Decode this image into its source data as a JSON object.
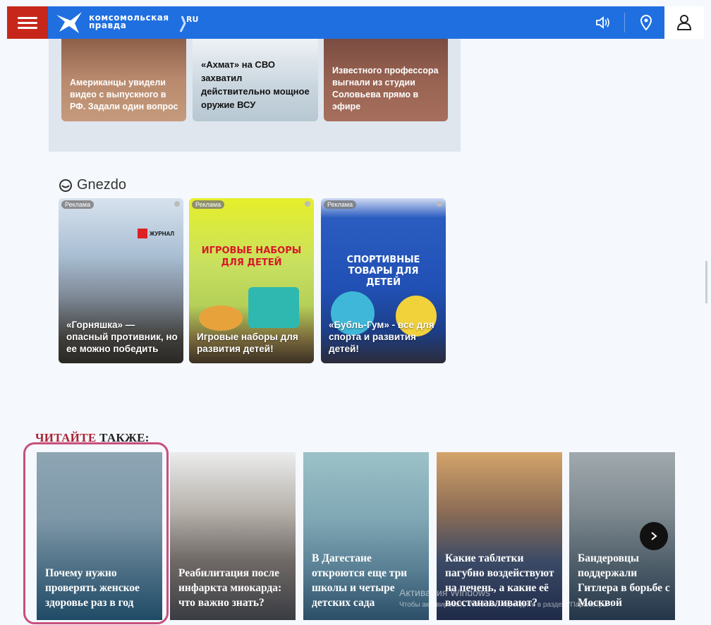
{
  "header": {
    "menu_icon": "menu-icon",
    "logo_line1": "комсомольская",
    "logo_line2": "правда",
    "logo_badge": "RU",
    "sound_icon": "speaker-icon",
    "location_icon": "location-pin-icon",
    "user_icon": "user-icon",
    "colors": {
      "bar": "#1f6fe0",
      "menu": "#c7271b"
    }
  },
  "top_news": [
    {
      "title": "Американцы увидели видео с выпускного в РФ. Задали один вопрос",
      "color": "#b58768"
    },
    {
      "title": "«Ахмат» на СВО захватил действительно мощное оружие ВСУ",
      "color": "#c9d6df"
    },
    {
      "title": "Известного профессора выгнали из студии Соловьева прямо в эфире",
      "color": "#9c6655"
    }
  ],
  "gnezdo": {
    "logo": "Gnezdo",
    "ads": [
      {
        "label": "Реклама",
        "title": "«Горняшка» — опасный противник, но ее можно победить",
        "brand": "ЖУРНАЛ"
      },
      {
        "label": "Реклама",
        "title": "Игровые наборы для развития детей!",
        "inner": "ИГРОВЫЕ НАБОРЫ ДЛЯ ДЕТЕЙ"
      },
      {
        "label": "Реклама",
        "title": "«Бубль-Гум» - все для спорта и развития детей!",
        "inner": "СПОРТИВНЫЕ ТОВАРЫ ДЛЯ ДЕТЕЙ"
      }
    ]
  },
  "read_also": {
    "part1": "ЧИТАЙТЕ",
    "part2": " ТАКЖЕ:",
    "cards": [
      {
        "title": "Почему нужно проверять женское здоровье раз в год"
      },
      {
        "title": "Реабилитация после инфаркта миокарда: что важно знать?"
      },
      {
        "title": "В Дагестане откроются еще три школы и четыре детских сада"
      },
      {
        "title": "Какие таблетки пагубно воздействуют на печень, а какие её восстанавливают?"
      },
      {
        "title": "Бандеровцы поддержали Гитлера в борьбе с Москвой"
      }
    ],
    "next_icon": "chevron-right-icon"
  },
  "watermark": {
    "line1": "Активация Windows",
    "line2": "Чтобы активировать Windows, перейдите в раздел \"Параметры\"."
  }
}
